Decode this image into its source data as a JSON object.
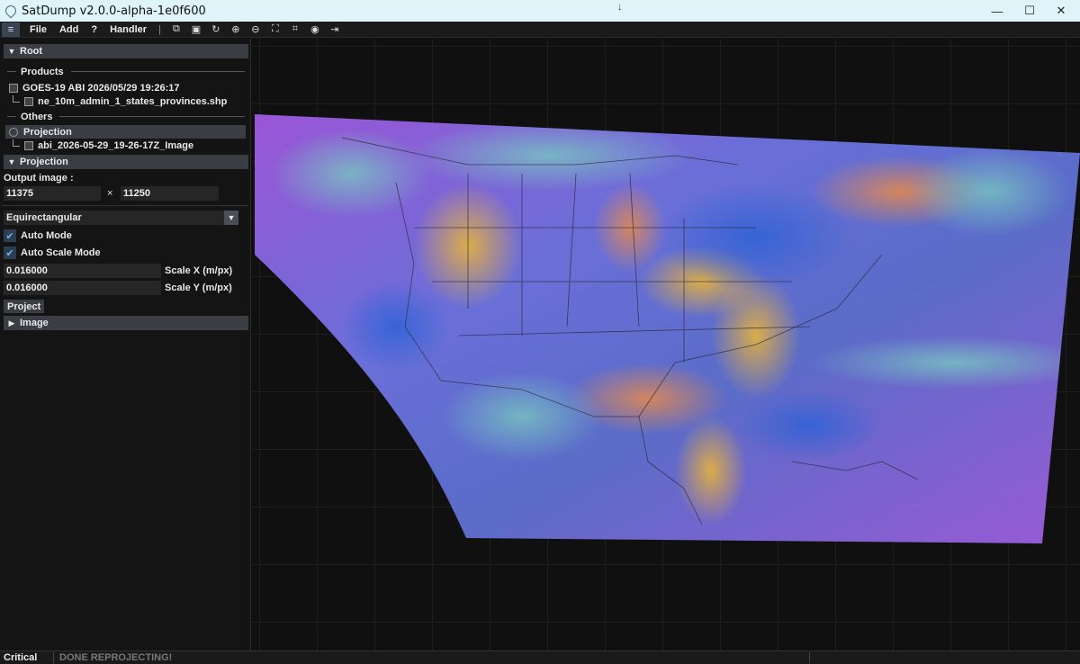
{
  "window": {
    "title": "SatDump v2.0.0-alpha-1e0f600",
    "minimize": "—",
    "maximize": "☐",
    "close": "✕"
  },
  "menu": {
    "hamburger": "≡",
    "items": [
      "File",
      "Add",
      "?",
      "Handler"
    ],
    "separator": "|",
    "tools": [
      "⧉",
      "💾",
      "↻",
      "⊕",
      "⊖",
      "⛶",
      "⌗",
      "🌐",
      "⇥"
    ]
  },
  "panel": {
    "root_label": "Root",
    "products_label": "Products",
    "product_item": "GOES-19 ABI 2026/05/29 19:26:17",
    "product_child": "ne_10m_admin_1_states_provinces.shp",
    "others_label": "Others",
    "projection_item": "Projection",
    "projection_child": "abi_2026-05-29_19-26-17Z_Image",
    "projection_section": "Projection",
    "output_image_label": "Output image :",
    "width_value": "11375",
    "times": "×",
    "height_value": "11250",
    "projection_type": "Equirectangular",
    "auto_mode": "Auto Mode",
    "auto_scale_mode": "Auto Scale Mode",
    "scale_x_value": "0.016000",
    "scale_x_label": "Scale X (m/px)",
    "scale_y_value": "0.016000",
    "scale_y_label": "Scale Y (m/px)",
    "project_button": "Project",
    "image_section": "Image"
  },
  "status": {
    "level": "Critical",
    "message": "DONE REPROJECTING!"
  },
  "colors": {
    "accent_check": "#6fb3ff",
    "header_bg": "#3a3d44",
    "titlebar_bg": "#dff4f8"
  }
}
